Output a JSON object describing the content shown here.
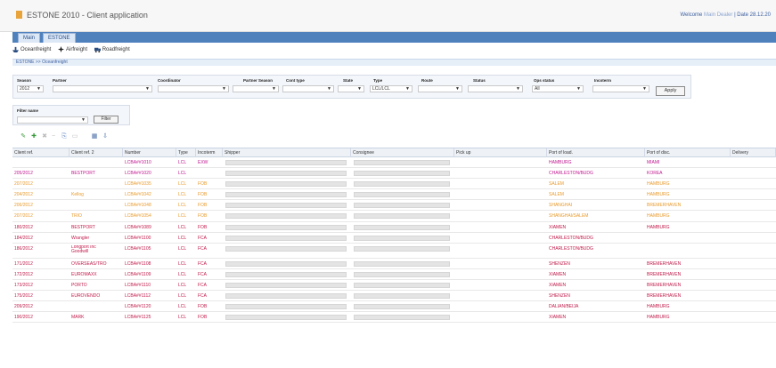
{
  "app": {
    "title": "ESTONE 2010 - Client application",
    "user_info": "Welcome",
    "user_link": "Main Dealer",
    "date_info": "| Date 28.12.20",
    "logo_color": "#e8a43a"
  },
  "tabs": [
    {
      "label": "Main"
    },
    {
      "label": "ESTONE"
    }
  ],
  "toolbar": {
    "items": [
      {
        "label": "Oceanfreight",
        "icon": "ship-icon"
      },
      {
        "label": "Airfreight",
        "icon": "plane-icon"
      },
      {
        "label": "Roadfreight",
        "icon": "truck-icon"
      }
    ]
  },
  "breadcrumb": "ESTONE >> Oceanfreight",
  "filters": {
    "items": [
      {
        "label": "Season",
        "value": "2012"
      },
      {
        "label": "Partner",
        "value": ""
      },
      {
        "label": "Coordinator",
        "value": ""
      },
      {
        "label": "Partner Season",
        "value": ""
      },
      {
        "label": "Cont type",
        "value": ""
      },
      {
        "label": "State",
        "value": ""
      },
      {
        "label": "Type",
        "value": "LCL/LCL"
      },
      {
        "label": "Route",
        "value": ""
      },
      {
        "label": "Status",
        "value": ""
      },
      {
        "label": "Ops status",
        "value": "All"
      },
      {
        "label": "Incoterm",
        "value": ""
      }
    ],
    "apply_label": "Apply"
  },
  "filter_panel": {
    "label": "Filter name",
    "value": "",
    "button": "Filter"
  },
  "grid": {
    "columns": [
      "Client ref.",
      "Client ref. 2",
      "Number",
      "Type",
      "Incoterm",
      "Shipper",
      "Consignee",
      "Pick up",
      "Port of load.",
      "Port of disc.",
      "Delivery"
    ],
    "rows": [
      {
        "color": "#c01890",
        "cells": [
          "",
          "",
          "LCBA##1010",
          "LCL",
          "EXW",
          "",
          "",
          "",
          "HAMBURG",
          "MIAMI",
          ""
        ]
      },
      {
        "color": "#c01890",
        "cells": [
          "205/2012",
          "BESTPORT",
          "LCBA##1020",
          "LCL",
          "",
          "",
          "",
          "",
          "CHARLESTON/BUDG",
          "KOREA",
          ""
        ]
      },
      {
        "color": "#e89a2c",
        "cells": [
          "207/2012",
          "",
          "LCBA##1035",
          "LCL",
          "FOB",
          "",
          "",
          "",
          "SALEM",
          "HAMBURG",
          ""
        ]
      },
      {
        "color": "#e89a2c",
        "cells": [
          "204/2012",
          "Kellog",
          "LCBA##1042",
          "LCL",
          "FOB",
          "",
          "",
          "",
          "SALEM",
          "HAMBURG",
          ""
        ]
      },
      {
        "color": "#e89a2c",
        "cells": [
          "206/2012",
          "",
          "LCBA##1048",
          "LCL",
          "FOB",
          "",
          "",
          "",
          "SHANGHAI",
          "BREMERHAVEN",
          ""
        ]
      },
      {
        "color": "#e89a2c",
        "cells": [
          "207/2012",
          "TRIO",
          "LCBA##1054",
          "LCL",
          "FOB",
          "",
          "",
          "",
          "SHANGHAI/SALEM",
          "HAMBURG",
          ""
        ]
      },
      {
        "color": "#c01848",
        "cells": [
          "180/2012",
          "BESTPORT",
          "LCBA##1089",
          "LCL",
          "FOB",
          "",
          "",
          "",
          "XIAMEN",
          "HAMBURG",
          ""
        ]
      },
      {
        "color": "#c01848",
        "cells": [
          "184/2012",
          "Wrangler",
          "LCBA##1100",
          "LCL",
          "FCA",
          "",
          "",
          "",
          "CHARLESTON/BUDG",
          "",
          ""
        ]
      },
      {
        "color": "#c01848",
        "cells": [
          "186/2012",
          "Longport Inc",
          "LCBA##1105",
          "LCL",
          "FCA",
          "",
          "",
          "",
          "CHARLESTON/BUDG",
          "",
          ""
        ],
        "wrap2": "Goodwill"
      },
      {
        "color": "#c01848",
        "cells": [
          "171/2012",
          "OVERSEAS/TRO",
          "LCBA##1108",
          "LCL",
          "FCA",
          "",
          "",
          "",
          "SHENZEN",
          "BREMERHAVEN",
          ""
        ]
      },
      {
        "color": "#c01848",
        "cells": [
          "172/2012",
          "EUROMAXX",
          "LCBA##1109",
          "LCL",
          "FCA",
          "",
          "",
          "",
          "XIAMEN",
          "BREMERHAVEN",
          ""
        ]
      },
      {
        "color": "#c01848",
        "cells": [
          "173/2012",
          "PORTO",
          "LCBA##1110",
          "LCL",
          "FCA",
          "",
          "",
          "",
          "XIAMEN",
          "BREMERHAVEN",
          ""
        ]
      },
      {
        "color": "#c01848",
        "cells": [
          "175/2012",
          "EUROVENDO",
          "LCBA##1112",
          "LCL",
          "FCA",
          "",
          "",
          "",
          "SHENZEN",
          "BREMERHAVEN",
          ""
        ]
      },
      {
        "color": "#c01848",
        "cells": [
          "209/2012",
          "",
          "LCBA##1120",
          "LCL",
          "FOB",
          "",
          "",
          "",
          "DALIAN/BEIJA",
          "HAMBURG",
          ""
        ]
      },
      {
        "color": "#c01848",
        "cells": [
          "190/2012",
          "MARK",
          "LCBA##1125",
          "LCL",
          "FOB",
          "",
          "",
          "",
          "XIAMEN",
          "HAMBURG",
          ""
        ]
      }
    ]
  }
}
